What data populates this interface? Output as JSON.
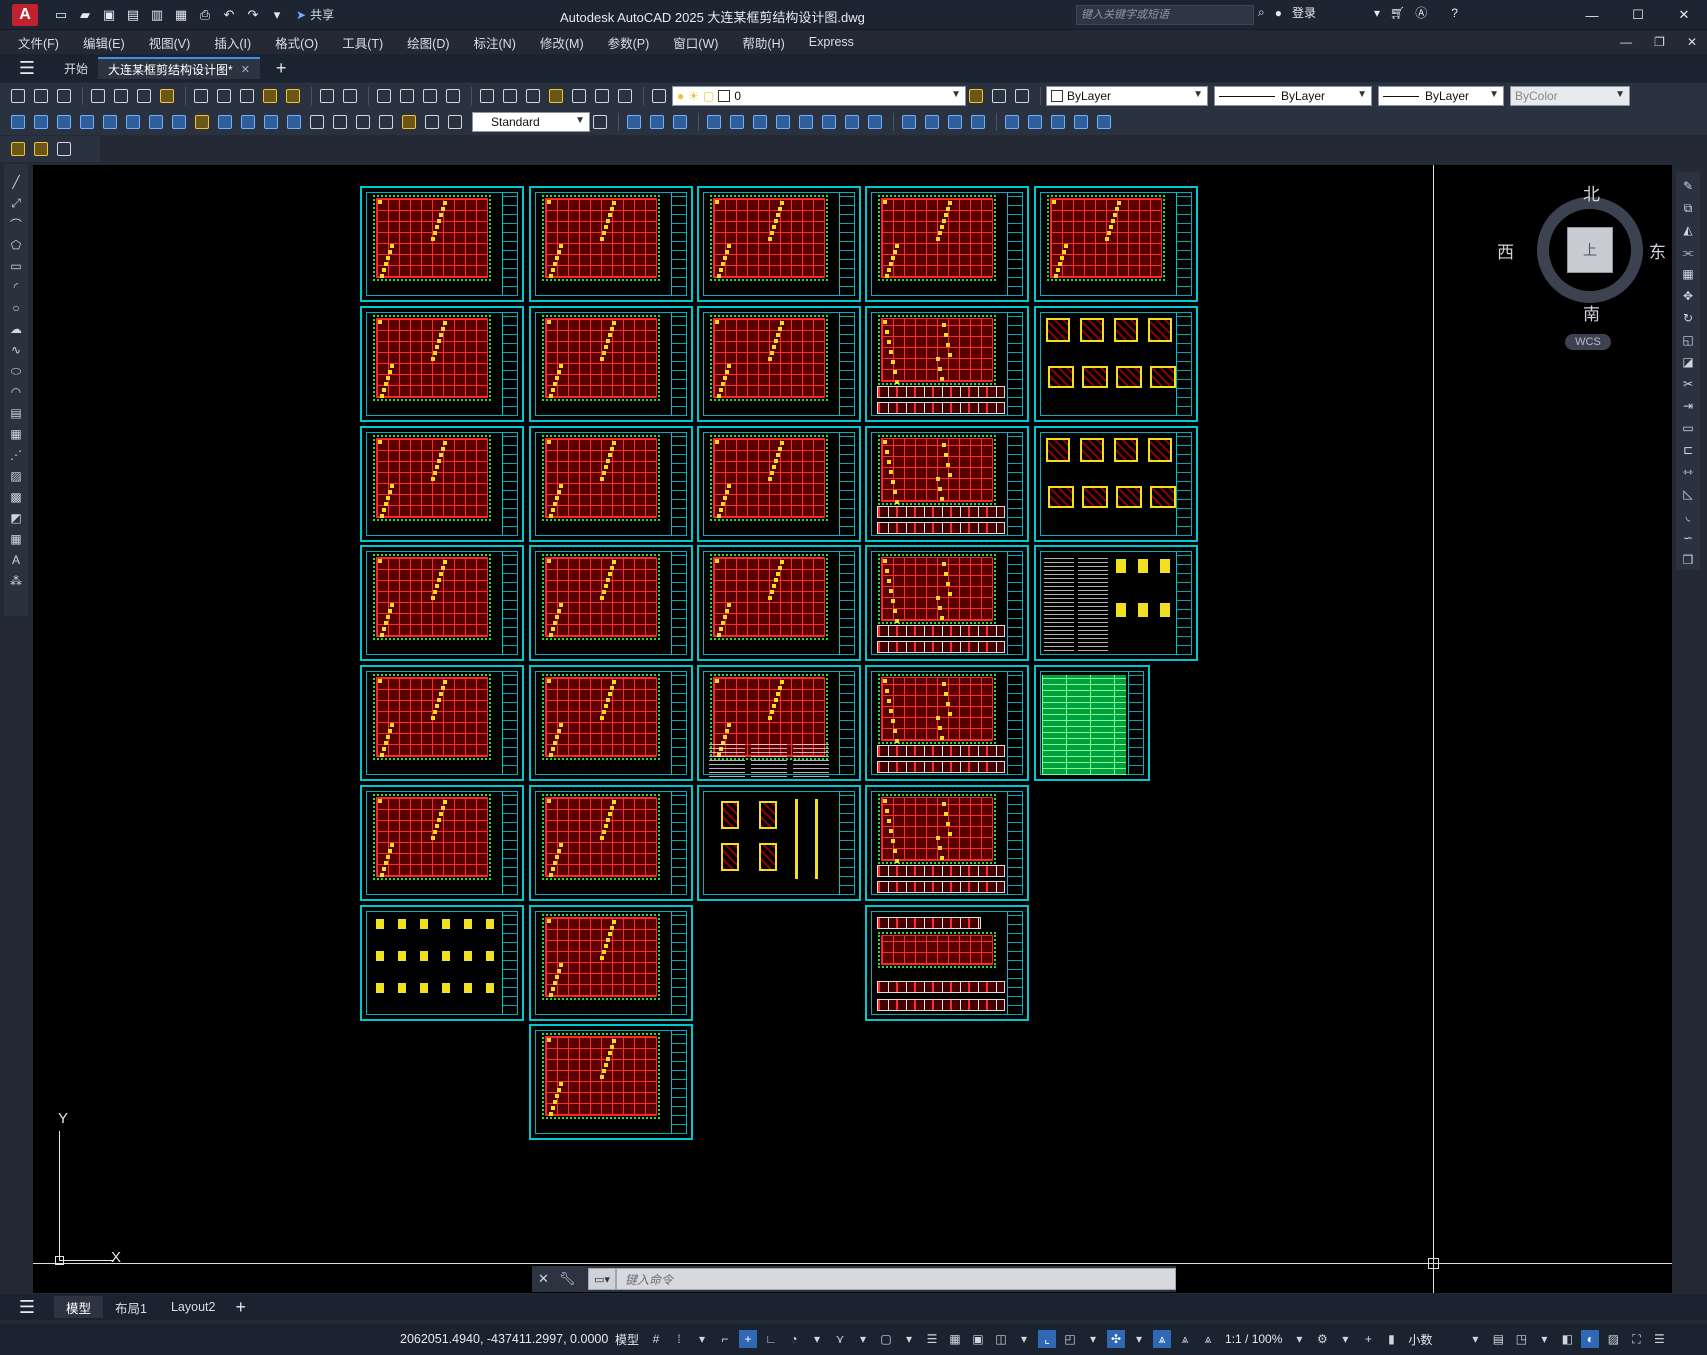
{
  "app": {
    "logo_letter": "A",
    "window_title": "Autodesk AutoCAD 2025    大连某框剪结构设计图.dwg",
    "share_label": "共享",
    "search_placeholder": "键入关键字或短语",
    "login_label": "登录"
  },
  "menu": [
    "文件(F)",
    "编辑(E)",
    "视图(V)",
    "插入(I)",
    "格式(O)",
    "工具(T)",
    "绘图(D)",
    "标注(N)",
    "修改(M)",
    "参数(P)",
    "窗口(W)",
    "帮助(H)",
    "Express"
  ],
  "tabs": {
    "start_label": "开始",
    "active_doc_label": "大连某框剪结构设计图*"
  },
  "properties": {
    "layer_value": "0",
    "color_value": "ByLayer",
    "linetype_value": "ByLayer",
    "lineweight_value": "ByLayer",
    "plotstyle_value": "ByColor",
    "dimstyle_value": "Standard"
  },
  "viewcube": {
    "north": "北",
    "south": "南",
    "west": "西",
    "east": "东",
    "face_label": "上",
    "wcs_label": "WCS"
  },
  "ucs": {
    "x_label": "X",
    "y_label": "Y"
  },
  "command": {
    "placeholder": "键入命令"
  },
  "layout_tabs": [
    "模型",
    "布局1",
    "Layout2"
  ],
  "status": {
    "coordinates": "2062051.4940, -437411.2997, 0.0000",
    "model_label": "模型",
    "scale_label": "1:1 / 100%",
    "units_label": "小数"
  },
  "colors": {
    "sheet_border": "#00c8d2",
    "grid_red": "#ff2a2a",
    "dim_green": "#28e028",
    "accent_blue": "#2f69b5"
  }
}
